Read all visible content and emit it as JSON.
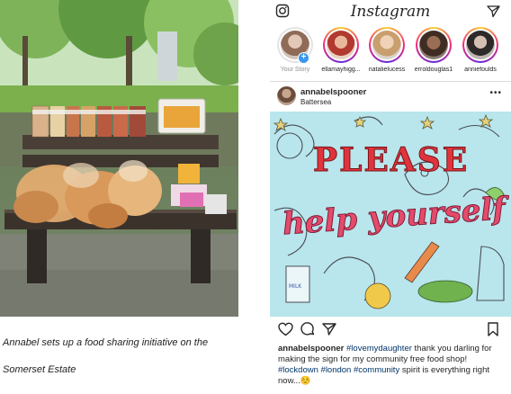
{
  "caption": {
    "line1": "Annabel sets up a food sharing initiative on the",
    "line2": "Somerset Estate"
  },
  "instagram": {
    "brand": "Instagram",
    "icons": {
      "camera": "camera-icon",
      "direct": "paper-plane-icon"
    },
    "stories": [
      {
        "name": "Your Story",
        "own": true,
        "color": "#c9b2a6"
      },
      {
        "name": "ellamayhigg...",
        "own": false,
        "color": "#c0504a"
      },
      {
        "name": "natalielucess",
        "own": false,
        "color": "#d9b893"
      },
      {
        "name": "erroldouglas1",
        "own": false,
        "color": "#6a4a3c"
      },
      {
        "name": "anniefoulds",
        "own": false,
        "color": "#9a8a80"
      }
    ],
    "post": {
      "username": "annabelspooner",
      "location": "Battersea",
      "more_icon": "more-options-icon",
      "image_text": {
        "line1": "PLEASE",
        "line2": "help yourself",
        "carton": "MILK"
      },
      "action_icons": [
        "heart-icon",
        "comment-icon",
        "share-icon",
        "bookmark-icon"
      ],
      "caption_user": "annabelspooner",
      "caption_parts": [
        {
          "text": "#lovemydaughter",
          "tag": true
        },
        {
          "text": " thank you darling for making the sign for my community free food shop! ",
          "tag": false
        },
        {
          "text": "#lockdown",
          "tag": true
        },
        {
          "text": " ",
          "tag": false
        },
        {
          "text": "#london",
          "tag": true
        },
        {
          "text": " ",
          "tag": false
        },
        {
          "text": "#community",
          "tag": true
        },
        {
          "text": " spirit is everything right now...",
          "tag": false
        },
        {
          "text": "☺️",
          "tag": false
        }
      ]
    }
  }
}
